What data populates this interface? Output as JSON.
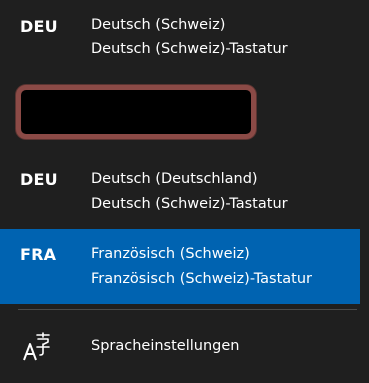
{
  "languages": [
    {
      "code": "DEU",
      "name": "Deutsch (Schweiz)",
      "layout": "Deutsch (Schweiz)-Tastatur",
      "selected": false
    },
    {
      "code": "DEU",
      "name": "Deutsch (Deutschland)",
      "layout": "Deutsch (Schweiz)-Tastatur",
      "selected": false
    },
    {
      "code": "FRA",
      "name": "Französisch (Schweiz)",
      "layout": "Französisch (Schweiz)-Tastatur",
      "selected": true
    }
  ],
  "settings": {
    "label": "Spracheinstellungen",
    "icon": "language-settings-icon"
  },
  "colors": {
    "background": "#1f1f1f",
    "selected": "#0063b1",
    "redaction_border": "#8b4a46"
  }
}
